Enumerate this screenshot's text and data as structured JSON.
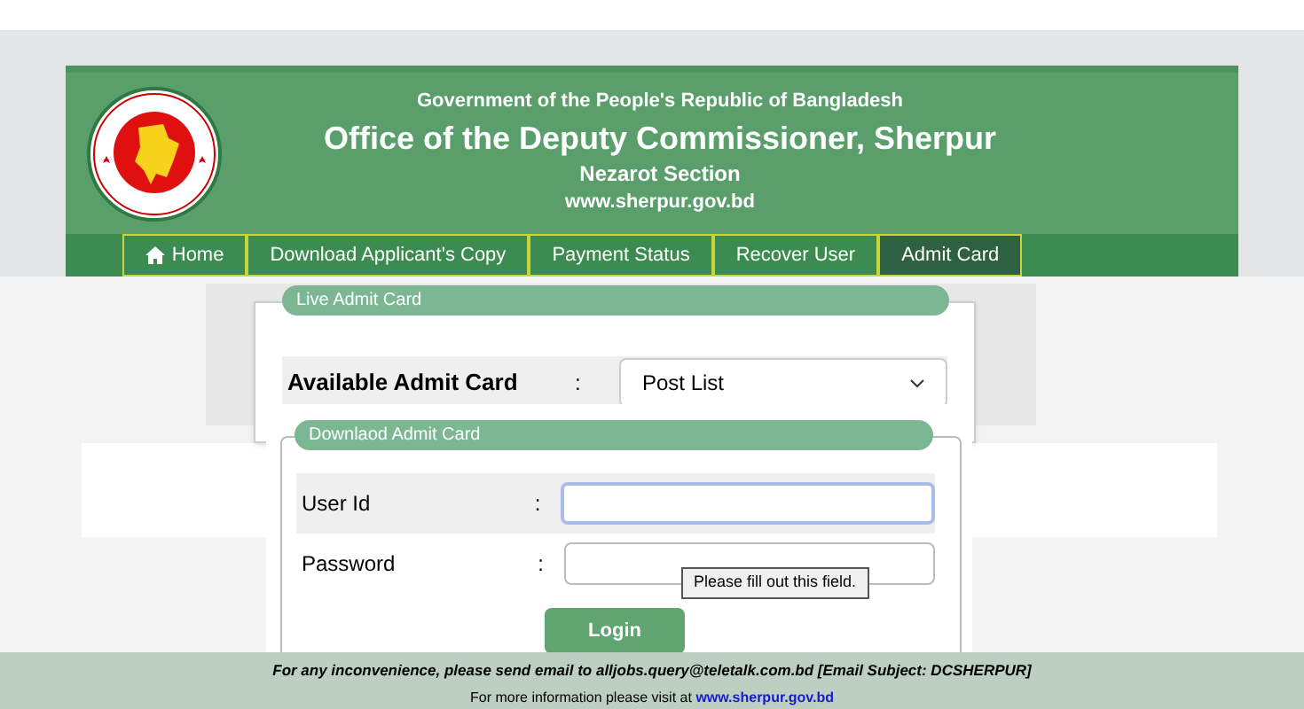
{
  "header": {
    "government": "Government of the People's Republic of Bangladesh",
    "office": "Office of the Deputy Commissioner, Sherpur",
    "section": "Nezarot Section",
    "website": "www.sherpur.gov.bd"
  },
  "nav": [
    {
      "label": "Home",
      "kind": "home",
      "selected": false
    },
    {
      "label": "Download Applicant's Copy",
      "kind": "link",
      "selected": false
    },
    {
      "label": "Payment Status",
      "kind": "link",
      "selected": false
    },
    {
      "label": "Recover User",
      "kind": "link",
      "selected": false
    },
    {
      "label": "Admit Card",
      "kind": "link",
      "selected": true
    }
  ],
  "live_panel": {
    "title": "Live Admit Card",
    "label": "Available Admit Card",
    "separator": ":",
    "select_value": "Post List"
  },
  "download_panel": {
    "title": "Downlaod Admit Card",
    "fields": [
      {
        "label": "User Id",
        "separator": ":",
        "focused": true
      },
      {
        "label": "Password",
        "separator": ":",
        "focused": false
      }
    ],
    "tooltip": "Please fill out this field.",
    "button": "Login"
  },
  "footer": {
    "notice": "For any inconvenience, please send email to alljobs.query@teletalk.com.bd [Email Subject: DCSHERPUR]",
    "info": "For more information please visit at",
    "link": "www.sherpur.gov.bd"
  }
}
